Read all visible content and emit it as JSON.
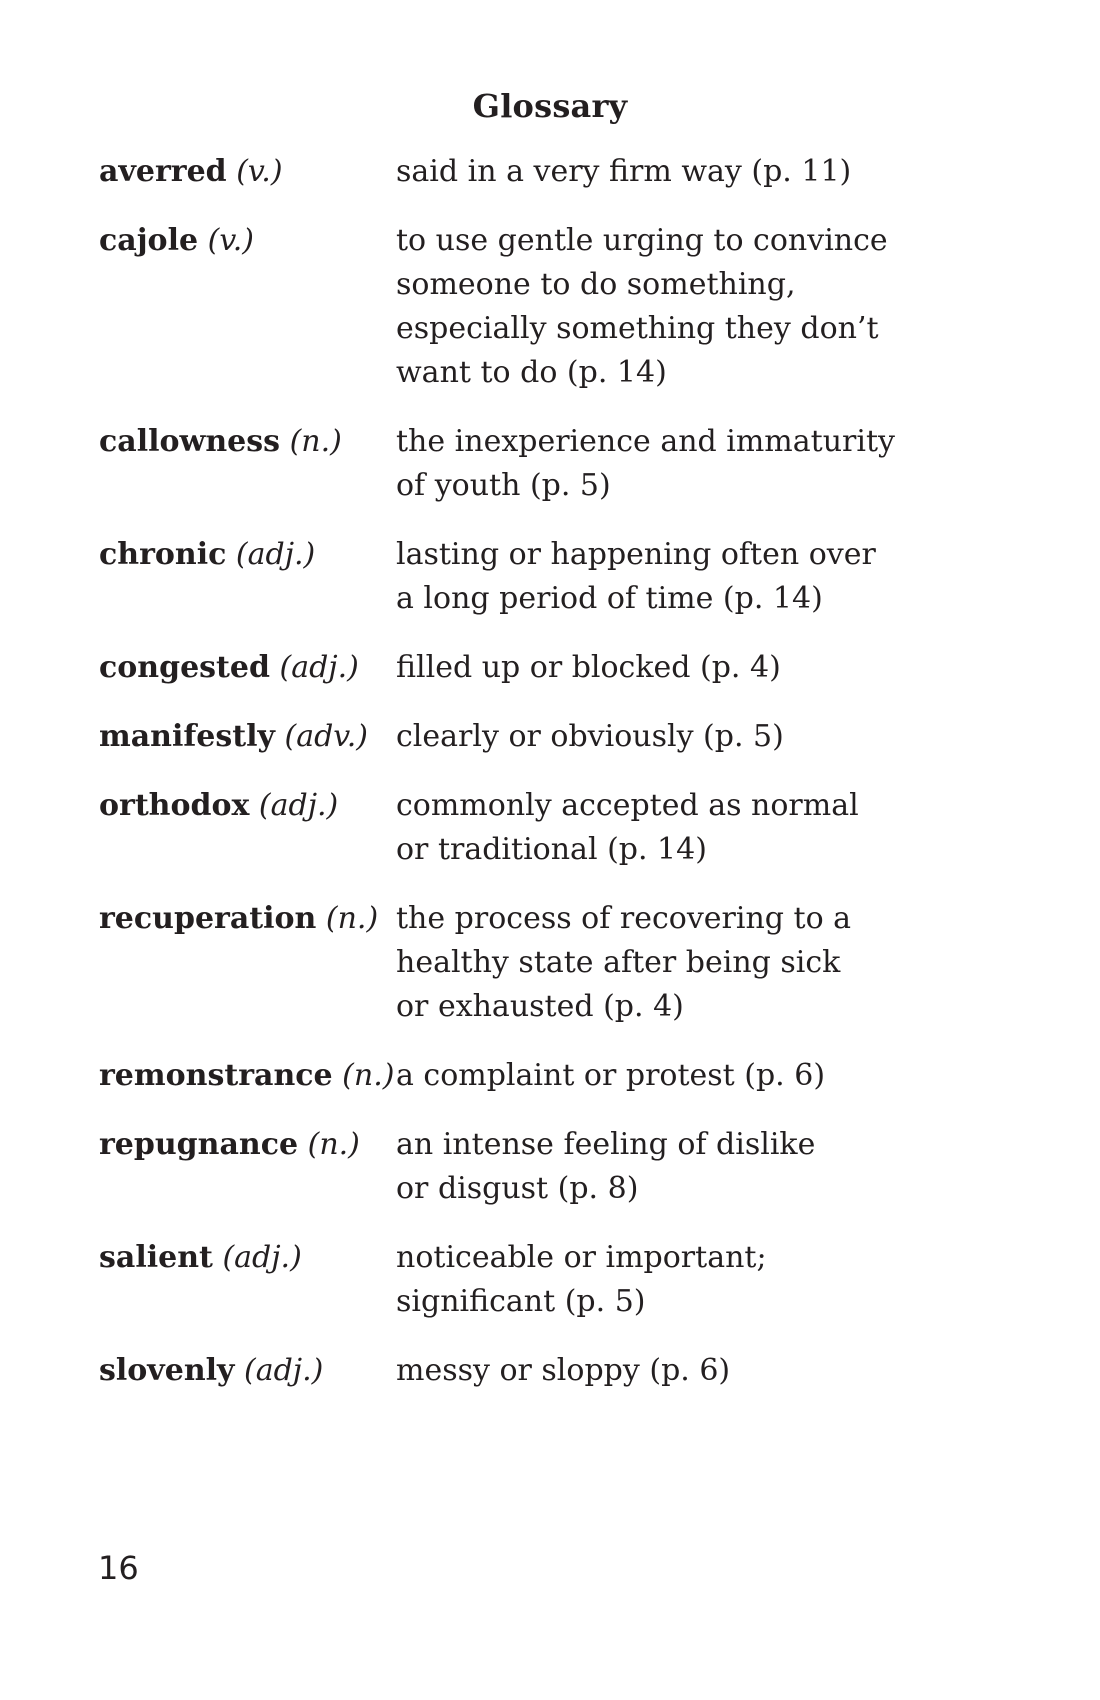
{
  "title": "Glossary",
  "entries": [
    {
      "term": "averred",
      "pos": "(v.)",
      "definition": [
        "said in a very firm way (p. 11)"
      ]
    },
    {
      "term": "cajole",
      "pos": "(v.)",
      "definition": [
        "to use gentle urging to convince",
        "someone to do something,",
        "especially something they don’t",
        "want to do (p. 14)"
      ]
    },
    {
      "term": "callowness",
      "pos": "(n.)",
      "definition": [
        "the inexperience and immaturity",
        "of youth (p. 5)"
      ]
    },
    {
      "term": "chronic",
      "pos": "(adj.)",
      "definition": [
        "lasting or happening often over",
        "a long period of time (p. 14)"
      ]
    },
    {
      "term": "congested",
      "pos": "(adj.)",
      "definition": [
        "filled up or blocked (p. 4)"
      ]
    },
    {
      "term": "manifestly",
      "pos": "(adv.)",
      "definition": [
        "clearly or obviously (p. 5)"
      ]
    },
    {
      "term": "orthodox",
      "pos": "(adj.)",
      "definition": [
        "commonly accepted as normal",
        "or traditional (p. 14)"
      ]
    },
    {
      "term": "recuperation",
      "pos": "(n.)",
      "definition": [
        "the process of recovering to a",
        "healthy state after being sick",
        "or exhausted (p. 4)"
      ]
    },
    {
      "term": "remonstrance",
      "pos": "(n.)",
      "definition": [
        "a complaint or protest (p. 6)"
      ]
    },
    {
      "term": "repugnance",
      "pos": "(n.)",
      "definition": [
        "an intense feeling of dislike",
        "or disgust (p. 8)"
      ]
    },
    {
      "term": "salient",
      "pos": "(adj.)",
      "definition": [
        "noticeable or important;",
        "significant (p. 5)"
      ]
    },
    {
      "term": "slovenly",
      "pos": "(adj.)",
      "definition": [
        "messy or sloppy (p. 6)"
      ]
    }
  ],
  "page_number": "16"
}
